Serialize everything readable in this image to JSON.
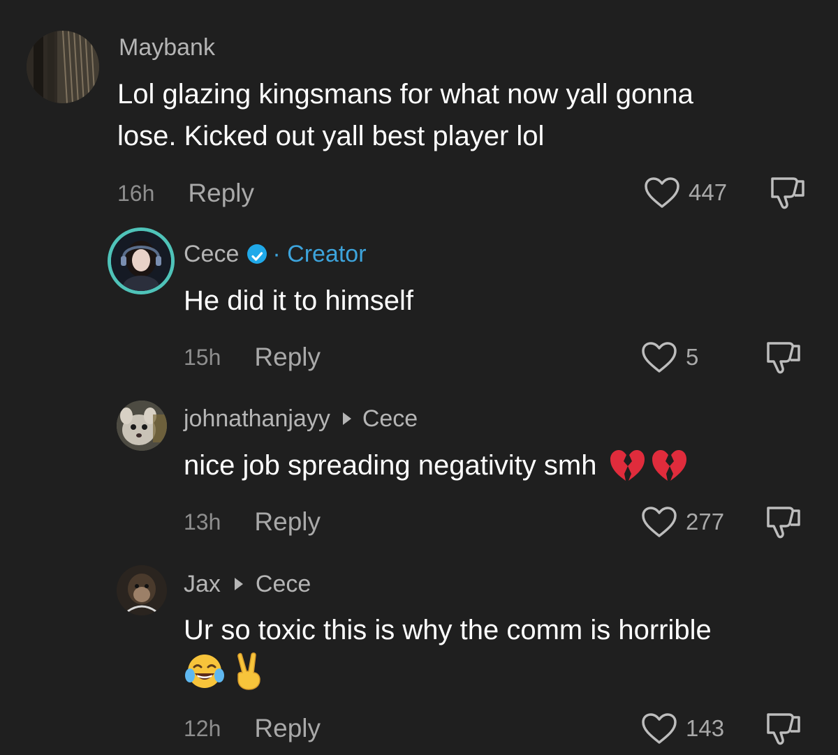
{
  "comments": [
    {
      "username": "Maybank",
      "text_lines": [
        "Lol glazing kingsmans for what now yall gonna",
        "lose. Kicked out yall best player lol"
      ],
      "time": "16h",
      "reply_label": "Reply",
      "likes": "447"
    },
    {
      "username": "Cece",
      "badge": "· Creator",
      "text_lines": [
        "He did it to himself"
      ],
      "time": "15h",
      "reply_label": "Reply",
      "likes": "5"
    },
    {
      "username": "johnathanjayy",
      "reply_to": "Cece",
      "text_lines": [
        "nice job spreading negativity smh"
      ],
      "time": "13h",
      "reply_label": "Reply",
      "likes": "277"
    },
    {
      "username": "Jax",
      "reply_to": "Cece",
      "text_lines": [
        "Ur so toxic this is why the comm is horrible"
      ],
      "time": "12h",
      "reply_label": "Reply",
      "likes": "143"
    }
  ],
  "icons": {
    "like": "heart-outline-icon",
    "dislike": "thumbs-down-icon",
    "verified": "verified-badge-icon",
    "broken_heart": "broken-heart-emoji",
    "laughing": "tears-of-joy-emoji",
    "victory": "victory-hand-emoji"
  },
  "colors": {
    "background": "#1f1f1f",
    "creator_accent": "#3da4dc",
    "verified": "#20a9e9"
  }
}
